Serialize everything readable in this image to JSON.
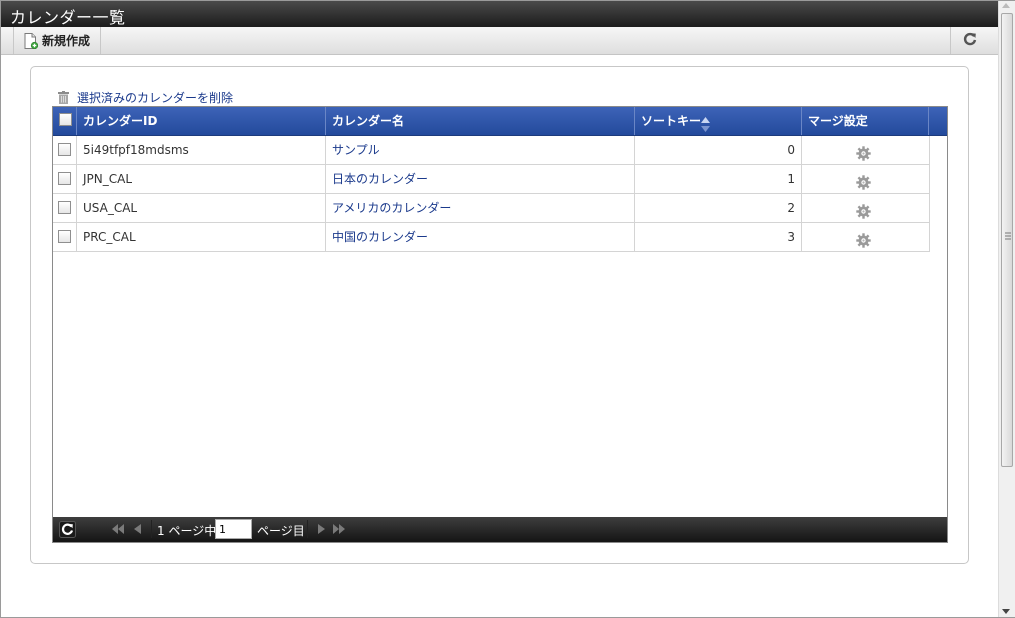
{
  "window": {
    "title": "カレンダー一覧"
  },
  "toolbar": {
    "new_label": "新規作成",
    "reload_icon": "reload-icon"
  },
  "panel": {
    "delete_label": "選択済みのカレンダーを削除"
  },
  "grid": {
    "columns": [
      "カレンダーID",
      "カレンダー名",
      "ソートキー",
      "マージ設定"
    ],
    "sort_column": "ソートキー",
    "rows": [
      {
        "id": "5i49tfpf18mdsms",
        "name": "サンプル",
        "sort_key": "0"
      },
      {
        "id": "JPN_CAL",
        "name": "日本のカレンダー",
        "sort_key": "1"
      },
      {
        "id": "USA_CAL",
        "name": "アメリカのカレンダー",
        "sort_key": "2"
      },
      {
        "id": "PRC_CAL",
        "name": "中国のカレンダー",
        "sort_key": "3"
      }
    ]
  },
  "pager": {
    "current_page": "1",
    "page_text": "1 ページ中",
    "page_suffix": "ページ目"
  },
  "colors": {
    "header_blue": "#2d54a8",
    "link": "#1b3a8c",
    "titlebar": "#2a2a2a"
  }
}
